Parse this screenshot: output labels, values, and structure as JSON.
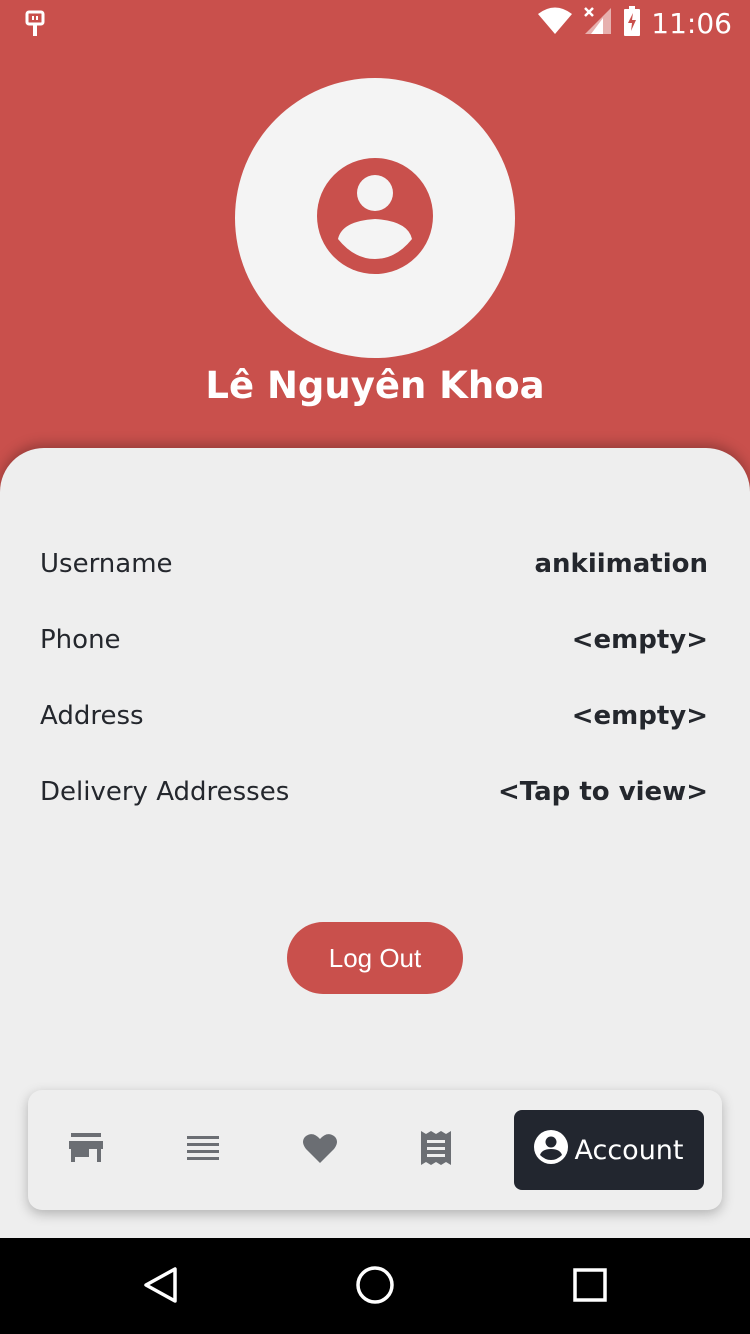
{
  "status_bar": {
    "time": "11:06"
  },
  "profile": {
    "name": "Lê Nguyên Khoa"
  },
  "info": {
    "rows": [
      {
        "label": "Username",
        "value": "ankiimation"
      },
      {
        "label": "Phone",
        "value": "<empty>"
      },
      {
        "label": "Address",
        "value": "<empty>"
      },
      {
        "label": "Delivery Addresses",
        "value": "<Tap to view>"
      }
    ]
  },
  "actions": {
    "logout_label": "Log Out"
  },
  "bottom_nav": {
    "items": [
      {
        "icon": "store-icon"
      },
      {
        "icon": "list-icon"
      },
      {
        "icon": "heart-icon"
      },
      {
        "icon": "receipt-icon"
      }
    ],
    "active": {
      "icon": "account-circle-icon",
      "label": "Account"
    }
  },
  "colors": {
    "primary": "#c9504c",
    "card": "#eeeeee",
    "dark": "#22262f",
    "text": "#24272d",
    "icon_gray": "#6b6e73"
  }
}
